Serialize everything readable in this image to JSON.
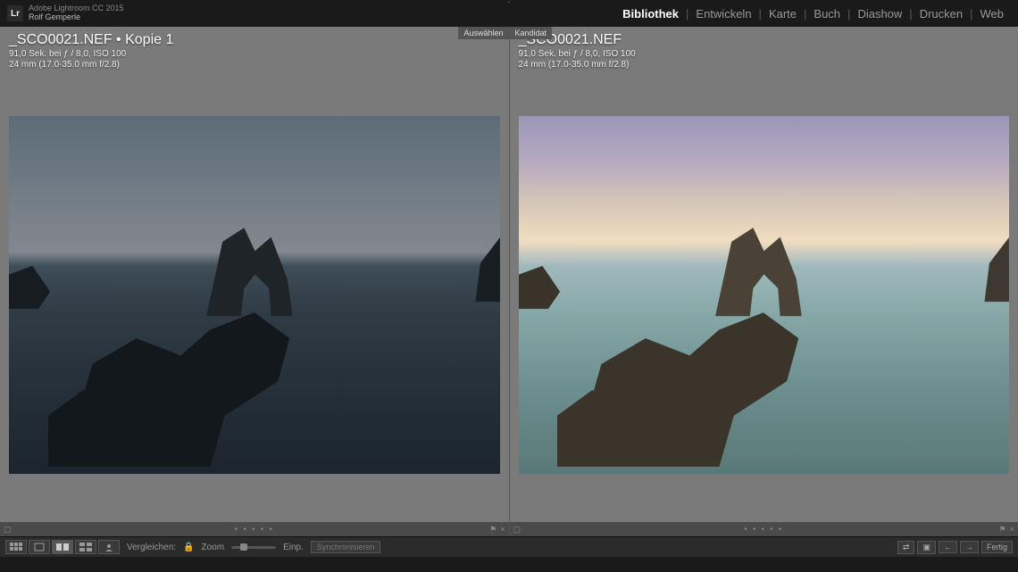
{
  "app": {
    "product": "Adobe Lightroom CC 2015",
    "user": "Rolf Gemperle",
    "logo": "Lr"
  },
  "modules": {
    "items": [
      "Bibliothek",
      "Entwickeln",
      "Karte",
      "Buch",
      "Diashow",
      "Drucken",
      "Web"
    ],
    "active": "Bibliothek"
  },
  "compare": {
    "select_tag": "Auswählen",
    "candidate_tag": "Kandidat",
    "left": {
      "filename": "_SCO0021.NEF  •  Kopie 1",
      "exposure": "91,0 Sek. bei ƒ / 8,0, ISO 100",
      "lens": "24 mm (17.0-35.0 mm f/2.8)"
    },
    "right": {
      "filename": "_SCO0021.NEF",
      "exposure": "91,0 Sek. bei ƒ / 8,0, ISO 100",
      "lens": "24 mm (17.0-35.0 mm f/2.8)"
    },
    "rating_dots": "• • • • •"
  },
  "toolbar": {
    "compare_label": "Vergleichen:",
    "zoom_label": "Zoom",
    "fit_label": "Einp.",
    "sync_label": "Synchronisieren",
    "done_label": "Fertig",
    "swap_icon": "⇄",
    "prev_icon": "←",
    "next_icon": "→"
  },
  "icons": {
    "close": "×",
    "flag": "⚑",
    "lock": "🔒"
  }
}
